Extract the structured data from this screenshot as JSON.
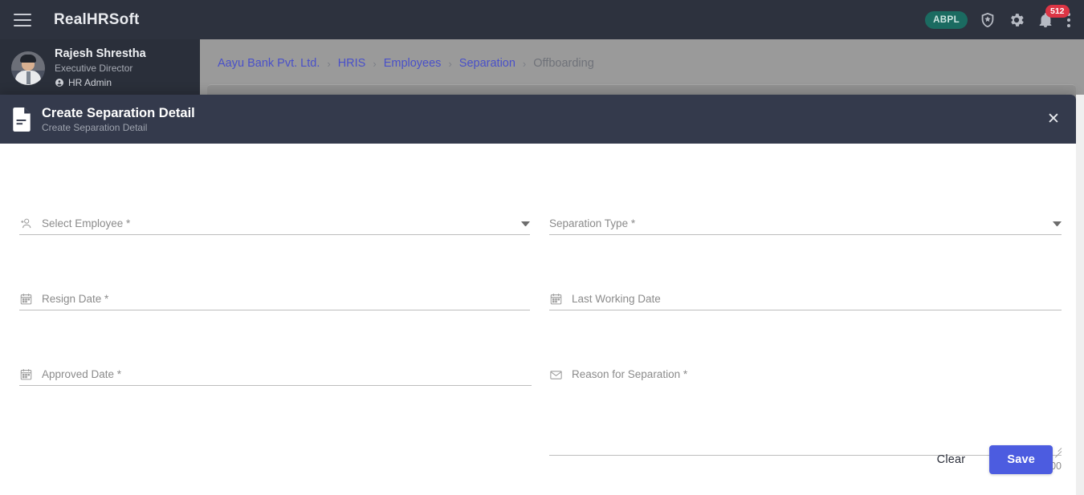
{
  "topbar": {
    "brand": "RealHRSoft",
    "menu_icon": "hamburger-icon",
    "org_badge": "ABPL",
    "shield_icon": "shield-star-icon",
    "settings_icon": "gear-icon",
    "notification_icon": "bell-icon",
    "notification_count": "512",
    "more_icon": "vertical-dots-icon"
  },
  "sidebar": {
    "user_name": "Rajesh Shrestha",
    "user_role": "Executive Director",
    "user_tag": "HR Admin",
    "tag_icon": "user-badge-icon",
    "avatar": "avatar"
  },
  "breadcrumb": {
    "items": [
      {
        "label": "Aayu Bank Pvt. Ltd.",
        "current": false
      },
      {
        "label": "HRIS",
        "current": false
      },
      {
        "label": "Employees",
        "current": false
      },
      {
        "label": "Separation",
        "current": false
      },
      {
        "label": "Offboarding",
        "current": true
      }
    ],
    "separator": "›"
  },
  "modal": {
    "icon": "document-icon",
    "title": "Create Separation Detail",
    "subtitle": "Create Separation Detail",
    "close_label": "✕",
    "fields": [
      {
        "name": "select-employee",
        "label": "Select Employee *",
        "value": "",
        "icon": "person-add-icon",
        "control": "dropdown"
      },
      {
        "name": "separation-type",
        "label": "Separation Type *",
        "value": "",
        "icon": "none",
        "control": "dropdown"
      },
      {
        "name": "resign-date",
        "label": "Resign Date *",
        "value": "",
        "icon": "calendar-icon",
        "control": "date"
      },
      {
        "name": "last-working-date",
        "label": "Last Working Date",
        "value": "",
        "icon": "calendar-icon",
        "control": "date"
      },
      {
        "name": "approved-date",
        "label": "Approved Date *",
        "value": "",
        "icon": "calendar-icon",
        "control": "date"
      },
      {
        "name": "reason-for-separation",
        "label": "Reason for Separation *",
        "value": "",
        "icon": "envelope-icon",
        "control": "textarea",
        "counter": "0 / 600",
        "maxlength": "600"
      }
    ],
    "clear_label": "Clear",
    "save_label": "Save"
  },
  "colors": {
    "topbar": "#2d323e",
    "sidebar": "#2a2f3a",
    "modal_header": "#343a4c",
    "breadcrumb_link": "#4950c9",
    "breadcrumb_current": "#6f7279",
    "badge_org": "#1b6b61",
    "badge_notification": "#dc3545",
    "save_button": "#4c5ce0",
    "overlay": "#9a9a9a"
  }
}
